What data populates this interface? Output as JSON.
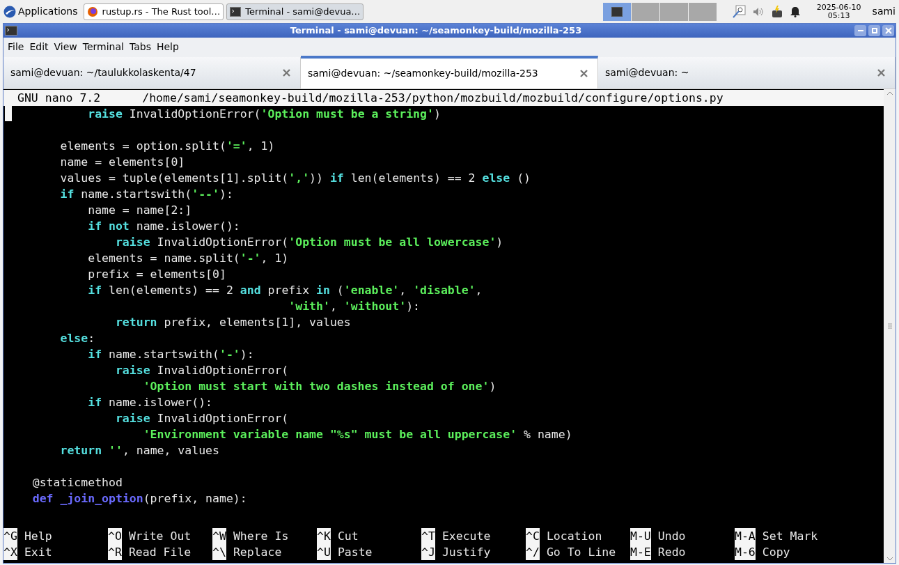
{
  "taskbar": {
    "apps_label": "Applications",
    "tasks": [
      {
        "label": "rustup.rs - The Rust tool…",
        "selected": false
      },
      {
        "label": "Terminal - sami@devua…",
        "selected": true
      }
    ],
    "workspaces": [
      {
        "selected": true
      },
      {
        "selected": false
      },
      {
        "selected": false
      },
      {
        "selected": false
      }
    ],
    "clock_date": "2025-06-10",
    "clock_time": "05:13",
    "user": "sami"
  },
  "window": {
    "title": "Terminal - sami@devuan: ~/seamonkey-build/mozilla-253"
  },
  "menu": [
    "File",
    "Edit",
    "View",
    "Terminal",
    "Tabs",
    "Help"
  ],
  "tabs": [
    {
      "label": "sami@devuan: ~/taulukkolaskenta/47",
      "selected": false
    },
    {
      "label": "sami@devuan: ~/seamonkey-build/mozilla-253",
      "selected": true
    },
    {
      "label": "sami@devuan: ~",
      "selected": false
    }
  ],
  "nano": {
    "version": "GNU nano 7.2",
    "path": "/home/sami/seamonkey-build/mozilla-253/python/mozbuild/mozbuild/configure/options.py",
    "lines": [
      {
        "segments": [
          {
            "kind": "kw",
            "text": "            raise"
          },
          {
            "kind": "plain",
            "text": " InvalidOptionError("
          },
          {
            "kind": "str",
            "text": "'Option must be a string'"
          },
          {
            "kind": "plain",
            "text": ")"
          }
        ]
      },
      {
        "blank_before": true,
        "segments": [
          {
            "kind": "plain",
            "text": "        elements = option.split("
          },
          {
            "kind": "str",
            "text": "'='"
          },
          {
            "kind": "plain",
            "text": ", 1)"
          }
        ]
      },
      {
        "segments": [
          {
            "kind": "plain",
            "text": "        name = elements[0]"
          }
        ]
      },
      {
        "segments": [
          {
            "kind": "plain",
            "text": "        values = tuple(elements[1].split("
          },
          {
            "kind": "str",
            "text": "','"
          },
          {
            "kind": "plain",
            "text": ")) "
          },
          {
            "kind": "kw",
            "text": "if"
          },
          {
            "kind": "plain",
            "text": " len(elements) == 2 "
          },
          {
            "kind": "kw",
            "text": "else"
          },
          {
            "kind": "plain",
            "text": " ()"
          }
        ]
      },
      {
        "segments": [
          {
            "kind": "kw",
            "text": "        if"
          },
          {
            "kind": "plain",
            "text": " name.startswith("
          },
          {
            "kind": "str",
            "text": "'--'"
          },
          {
            "kind": "plain",
            "text": "):"
          }
        ]
      },
      {
        "segments": [
          {
            "kind": "plain",
            "text": "            name = name[2:]"
          }
        ]
      },
      {
        "segments": [
          {
            "kind": "kw",
            "text": "            if not"
          },
          {
            "kind": "plain",
            "text": " name.islower():"
          }
        ]
      },
      {
        "segments": [
          {
            "kind": "kw",
            "text": "                raise"
          },
          {
            "kind": "plain",
            "text": " InvalidOptionError("
          },
          {
            "kind": "str",
            "text": "'Option must be all lowercase'"
          },
          {
            "kind": "plain",
            "text": ")"
          }
        ]
      },
      {
        "segments": [
          {
            "kind": "plain",
            "text": "            elements = name.split("
          },
          {
            "kind": "str",
            "text": "'-'"
          },
          {
            "kind": "plain",
            "text": ", 1)"
          }
        ]
      },
      {
        "segments": [
          {
            "kind": "plain",
            "text": "            prefix = elements[0]"
          }
        ]
      },
      {
        "segments": [
          {
            "kind": "kw",
            "text": "            if"
          },
          {
            "kind": "plain",
            "text": " len(elements) == 2 "
          },
          {
            "kind": "kw",
            "text": "and"
          },
          {
            "kind": "plain",
            "text": " prefix "
          },
          {
            "kind": "kw",
            "text": "in"
          },
          {
            "kind": "plain",
            "text": " ("
          },
          {
            "kind": "str",
            "text": "'enable'"
          },
          {
            "kind": "plain",
            "text": ", "
          },
          {
            "kind": "str",
            "text": "'disable'"
          },
          {
            "kind": "plain",
            "text": ","
          }
        ]
      },
      {
        "segments": [
          {
            "kind": "str",
            "text": "                                         'with'"
          },
          {
            "kind": "plain",
            "text": ", "
          },
          {
            "kind": "str",
            "text": "'without'"
          },
          {
            "kind": "plain",
            "text": "):"
          }
        ]
      },
      {
        "segments": [
          {
            "kind": "kw",
            "text": "                return"
          },
          {
            "kind": "plain",
            "text": " prefix, elements[1], values"
          }
        ]
      },
      {
        "segments": [
          {
            "kind": "kw",
            "text": "        else"
          },
          {
            "kind": "plain",
            "text": ":"
          }
        ]
      },
      {
        "segments": [
          {
            "kind": "kw",
            "text": "            if"
          },
          {
            "kind": "plain",
            "text": " name.startswith("
          },
          {
            "kind": "str",
            "text": "'-'"
          },
          {
            "kind": "plain",
            "text": "):"
          }
        ]
      },
      {
        "segments": [
          {
            "kind": "kw",
            "text": "                raise"
          },
          {
            "kind": "plain",
            "text": " InvalidOptionError("
          }
        ]
      },
      {
        "segments": [
          {
            "kind": "str",
            "text": "                    'Option must start with two dashes instead of one'"
          },
          {
            "kind": "plain",
            "text": ")"
          }
        ]
      },
      {
        "segments": [
          {
            "kind": "kw",
            "text": "            if"
          },
          {
            "kind": "plain",
            "text": " name.islower():"
          }
        ]
      },
      {
        "segments": [
          {
            "kind": "kw",
            "text": "                raise"
          },
          {
            "kind": "plain",
            "text": " InvalidOptionError("
          }
        ]
      },
      {
        "segments": [
          {
            "kind": "str",
            "text": "                    'Environment variable name \"%s\" must be all uppercase'"
          },
          {
            "kind": "plain",
            "text": " % name)"
          }
        ]
      },
      {
        "segments": [
          {
            "kind": "kw",
            "text": "        return"
          },
          {
            "kind": "str",
            "text": " ''"
          },
          {
            "kind": "plain",
            "text": ", name, values"
          }
        ]
      },
      {
        "blank_before": true,
        "segments": [
          {
            "kind": "plain",
            "text": "    @staticmethod"
          }
        ]
      },
      {
        "segments": [
          {
            "kind": "def",
            "text": "    def"
          },
          {
            "kind": "def",
            "text": " _join_option"
          },
          {
            "kind": "plain",
            "text": "(prefix, name):"
          }
        ]
      }
    ],
    "shortcuts": [
      [
        {
          "key": "^G",
          "label": "Help"
        },
        {
          "key": "^X",
          "label": "Exit"
        }
      ],
      [
        {
          "key": "^O",
          "label": "Write Out"
        },
        {
          "key": "^R",
          "label": "Read File"
        }
      ],
      [
        {
          "key": "^W",
          "label": "Where Is"
        },
        {
          "key": "^\\",
          "label": "Replace"
        }
      ],
      [
        {
          "key": "^K",
          "label": "Cut"
        },
        {
          "key": "^U",
          "label": "Paste"
        }
      ],
      [
        {
          "key": "^T",
          "label": "Execute"
        },
        {
          "key": "^J",
          "label": "Justify"
        }
      ],
      [
        {
          "key": "^C",
          "label": "Location"
        },
        {
          "key": "^/",
          "label": "Go To Line"
        }
      ],
      [
        {
          "key": "M-U",
          "label": "Undo"
        },
        {
          "key": "M-E",
          "label": "Redo"
        }
      ],
      [
        {
          "key": "M-A",
          "label": "Set Mark"
        },
        {
          "key": "M-6",
          "label": "Copy"
        }
      ]
    ]
  }
}
